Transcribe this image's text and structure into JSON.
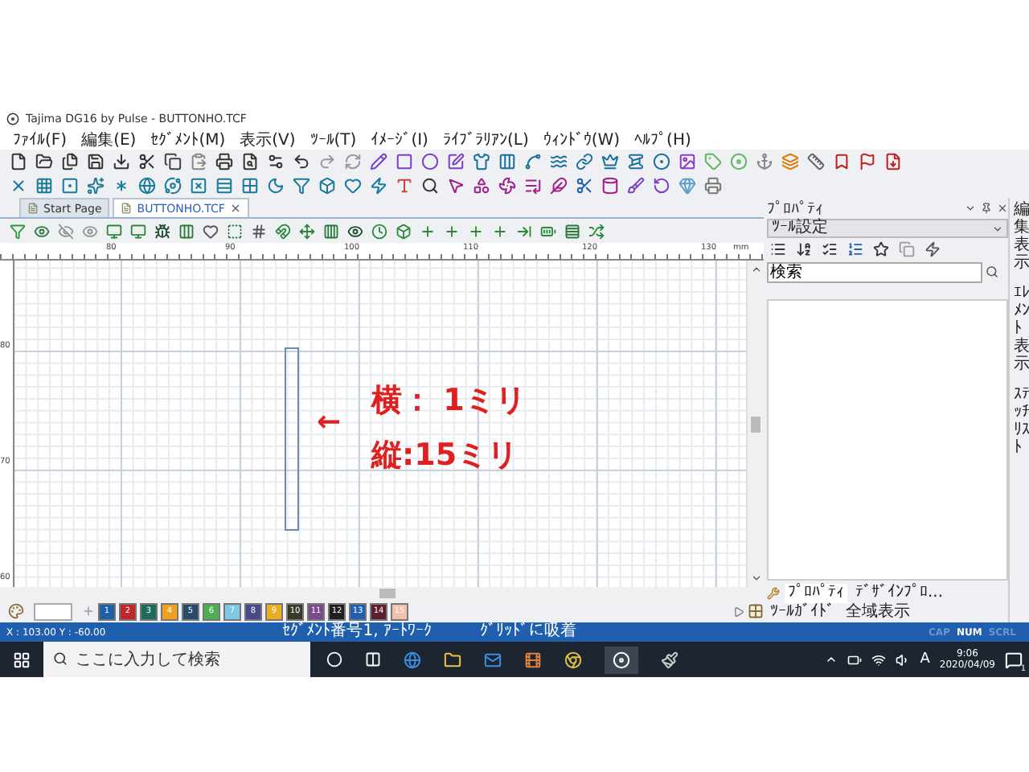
{
  "window": {
    "title": "Tajima DG16 by Pulse - BUTTONHO.TCF"
  },
  "menu": [
    "ﾌｧｲﾙ(F)",
    "編集(E)",
    "ｾｸﾞﾒﾝﾄ(M)",
    "表示(V)",
    "ﾂｰﾙ(T)",
    "ｲﾒｰｼﾞ(I)",
    "ﾗｲﾌﾞﾗﾘｱﾝ(L)",
    "ｳｨﾝﾄﾞｳ(W)",
    "ﾍﾙﾌﾟ(H)"
  ],
  "document_tabs": [
    {
      "label": "Start Page",
      "selected": false
    },
    {
      "label": "BUTTONHO.TCF",
      "selected": true
    }
  ],
  "ruler": {
    "top_labels": [
      "80",
      "90",
      "100",
      "110",
      "120",
      "130"
    ],
    "unit": "mm",
    "left_labels": [
      "80",
      "70",
      "60"
    ]
  },
  "canvas": {
    "arrow": "←",
    "lines": [
      "横： 1ミリ",
      "縦:15ミリ"
    ]
  },
  "palette": [
    {
      "label": "1",
      "color": "#1f5fa8"
    },
    {
      "label": "2",
      "color": "#c0282d"
    },
    {
      "label": "3",
      "color": "#1e6b5a"
    },
    {
      "label": "4",
      "color": "#f0a020"
    },
    {
      "label": "5",
      "color": "#2a4a6a"
    },
    {
      "label": "6",
      "color": "#4caf50"
    },
    {
      "label": "7",
      "color": "#7ec8e3"
    },
    {
      "label": "8",
      "color": "#4a4a8a"
    },
    {
      "label": "9",
      "color": "#e8b020"
    },
    {
      "label": "10",
      "color": "#3a3a2a"
    },
    {
      "label": "11",
      "color": "#7a4a8a"
    },
    {
      "label": "12",
      "color": "#202020"
    },
    {
      "label": "13",
      "color": "#2060b0"
    },
    {
      "label": "14",
      "color": "#5a2030"
    },
    {
      "label": "15",
      "color": "#f0c0b0"
    }
  ],
  "properties_panel": {
    "title": "ﾌﾟﾛﾊﾟﾃｨ",
    "dropdown": "ﾂｰﾙ設定",
    "search": {
      "value": "検索"
    },
    "bottom_tabs": [
      {
        "label": "ﾌﾟﾛﾊﾟﾃｨ",
        "selected": true
      },
      {
        "label": "ﾃﾞｻﾞｲﾝﾌﾟﾛ...",
        "selected": false
      },
      {
        "label": "ﾂｰﾙｶﾞｲﾄﾞ",
        "selected": false
      },
      {
        "label": "全域表示",
        "selected": false
      }
    ]
  },
  "side_tabs": [
    "編集表示",
    "ｴﾚﾒﾝﾄ表示",
    "ｽﾃｯﾁﾘｽﾄ"
  ],
  "status_bar": {
    "coordinates": "X : 103.00 Y : -60.00",
    "segment": "ｾｸﾞﾒﾝﾄ番号1, ｱｰﾄﾜｰｸ",
    "snap": "ｸﾞﾘｯﾄﾞに吸着",
    "indicators": [
      {
        "label": "CAP",
        "on": false
      },
      {
        "label": "NUM",
        "on": true
      },
      {
        "label": "SCRL",
        "on": false
      }
    ]
  },
  "taskbar": {
    "search": {
      "placeholder": "ここに入力して検索"
    },
    "ime": "A",
    "time": "9:06",
    "date": "2020/04/09",
    "notification_count": "1"
  }
}
